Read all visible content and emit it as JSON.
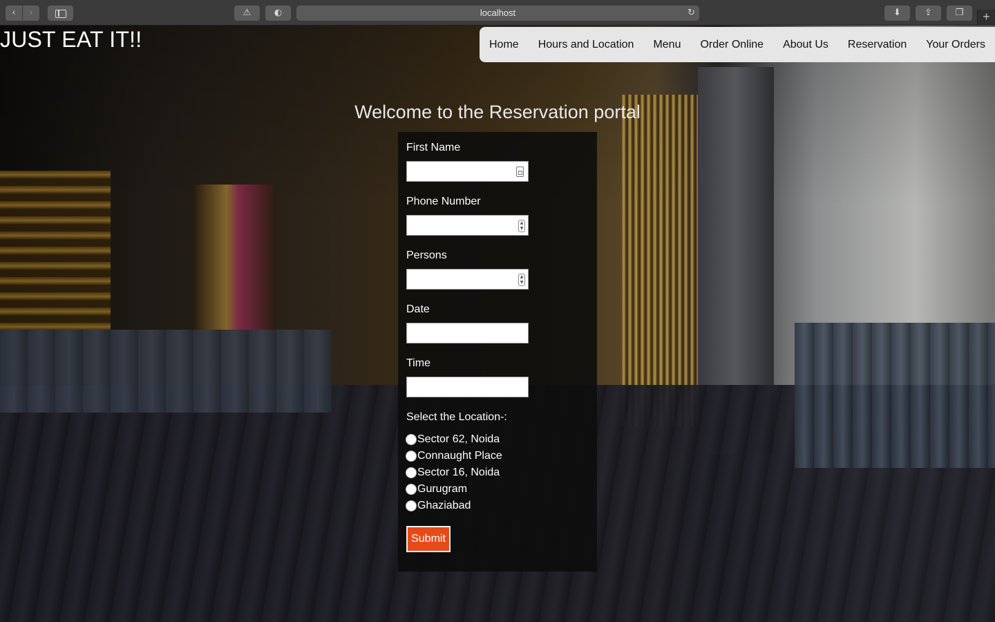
{
  "browser": {
    "url": "localhost",
    "back_icon": "‹",
    "forward_icon": "›",
    "warn_icon": "⚠",
    "privacy_icon": "◐",
    "reload_icon": "↻",
    "download_icon": "⬇",
    "share_icon": "⇪",
    "tabs_icon": "❐",
    "newtab_icon": "+"
  },
  "site": {
    "brand": "JUST EAT IT!!",
    "nav": [
      "Home",
      "Hours and Location",
      "Menu",
      "Order Online",
      "About Us",
      "Reservation",
      "Your Orders"
    ]
  },
  "portal": {
    "title": "Welcome to the Reservation portal",
    "fields": {
      "first_name": "First Name",
      "phone": "Phone Number",
      "persons": "Persons",
      "date": "Date",
      "time": "Time"
    },
    "location_label": "Select the Location-:",
    "locations": [
      "Sector 62, Noida",
      "Connaught Place",
      "Sector 16, Noida",
      "Gurugram",
      "Ghaziabad"
    ],
    "spin_up": "▲",
    "spin_down": "▼",
    "submit": "Submit"
  }
}
